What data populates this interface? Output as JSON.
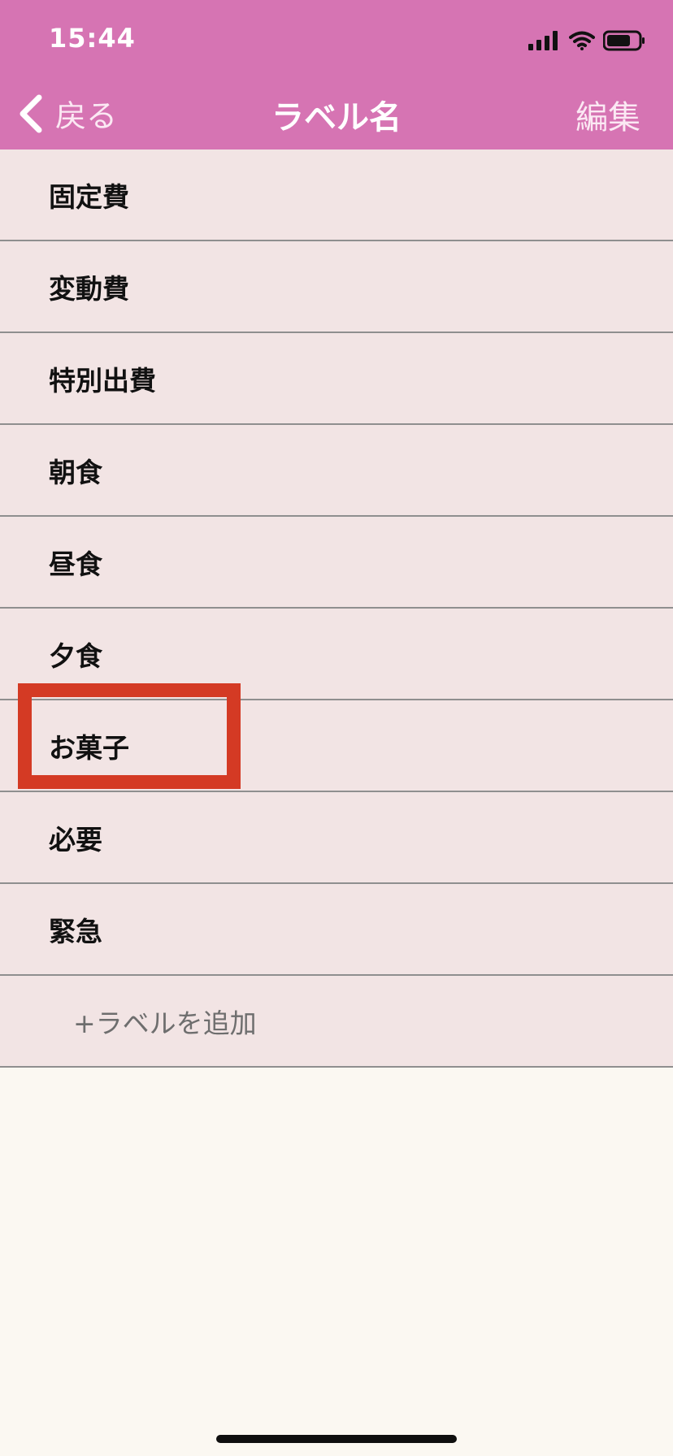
{
  "status_bar": {
    "time": "15:44",
    "signal_icon": "cellular-signal-icon",
    "wifi_icon": "wifi-icon",
    "battery_icon": "battery-icon"
  },
  "nav": {
    "back_label": "戻る",
    "title": "ラベル名",
    "edit_label": "編集",
    "back_icon": "chevron-left-icon"
  },
  "labels": [
    "固定費",
    "変動費",
    "特別出費",
    "朝食",
    "昼食",
    "夕食",
    "お菓子",
    "必要",
    "緊急"
  ],
  "add_label": "+ラベルを追加",
  "colors": {
    "header": "#d674b3",
    "list_bg": "#f2e4e4",
    "page_bg": "#fbf8f2",
    "highlight": "#d43a24"
  }
}
